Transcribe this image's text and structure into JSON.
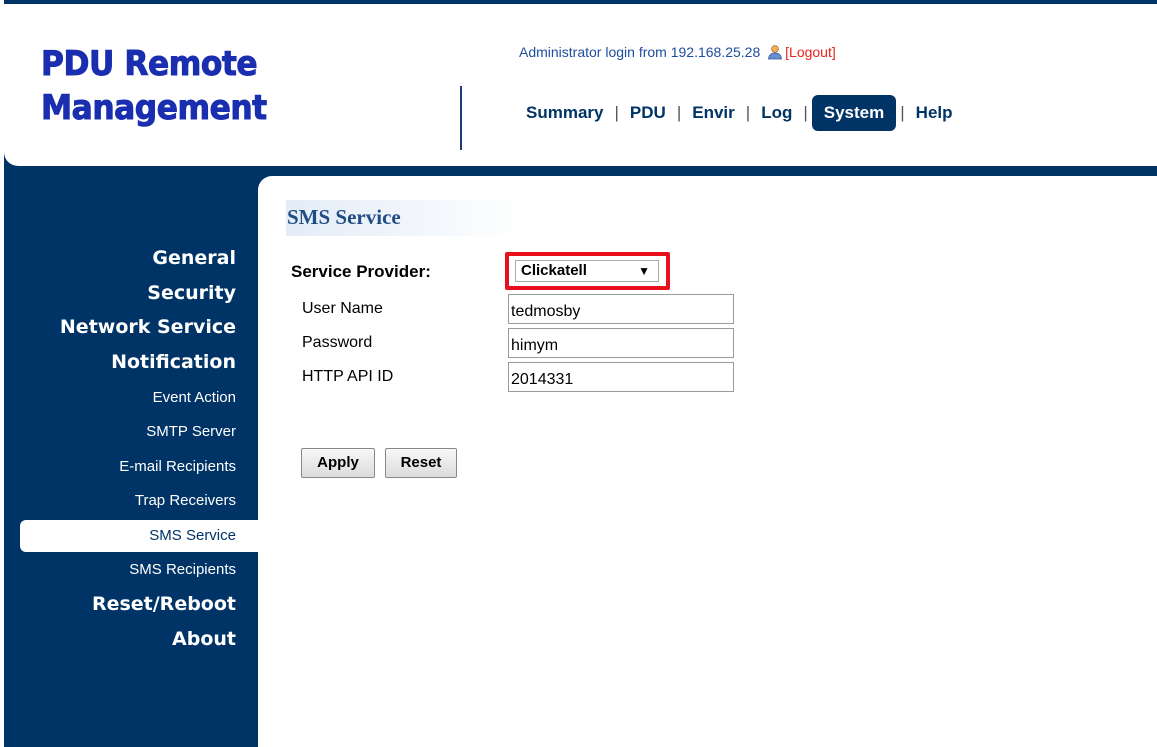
{
  "header": {
    "logo_line1": "PDU Remote",
    "logo_line2": "Management",
    "login_text": "Administrator login from 192.168.25.28",
    "logout_label": "[Logout]",
    "nav": [
      {
        "label": "Summary"
      },
      {
        "label": "PDU"
      },
      {
        "label": "Envir"
      },
      {
        "label": "Log"
      },
      {
        "label": "System",
        "active": true
      },
      {
        "label": "Help"
      }
    ],
    "separator": "|"
  },
  "sidebar": {
    "items": [
      {
        "label": "General"
      },
      {
        "label": "Security"
      },
      {
        "label": "Network Service"
      },
      {
        "label": "Notification"
      },
      {
        "label": "Event Action"
      },
      {
        "label": "SMTP Server"
      },
      {
        "label": "E-mail Recipients"
      },
      {
        "label": "Trap Receivers"
      },
      {
        "label": "SMS Service",
        "active": true
      },
      {
        "label": "SMS Recipients"
      },
      {
        "label": "Reset/Reboot"
      },
      {
        "label": "About"
      }
    ]
  },
  "main": {
    "title": "SMS Service",
    "provider_label": "Service Provider:",
    "provider_value": "Clickatell",
    "fields": [
      {
        "label": "User Name",
        "value": "tedmosby"
      },
      {
        "label": "Password",
        "value": "himym"
      },
      {
        "label": "HTTP API ID",
        "value": "2014331"
      }
    ],
    "apply_label": "Apply",
    "reset_label": "Reset"
  },
  "colors": {
    "brand_navy": "#003366",
    "logo_blue": "#1a2fb0",
    "highlight_red": "#e8101c",
    "logout_red": "#e8231c"
  },
  "icons": {
    "user": "user-icon",
    "dropdown": "chevron-down-icon"
  }
}
